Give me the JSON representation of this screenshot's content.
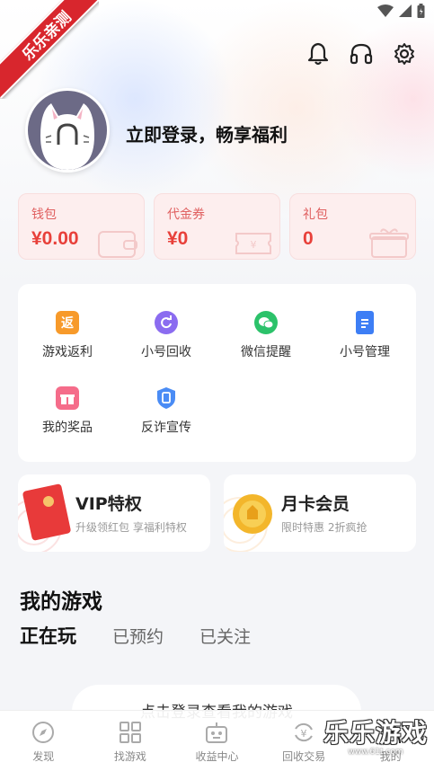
{
  "ribbon": {
    "text": "乐乐亲测"
  },
  "header": {
    "icons": [
      "bell-icon",
      "headset-icon",
      "gear-icon"
    ]
  },
  "profile": {
    "login_prompt": "立即登录，畅享福利"
  },
  "cards": [
    {
      "label": "钱包",
      "value": "¥0.00",
      "icon": "wallet-icon"
    },
    {
      "label": "代金券",
      "value": "¥0",
      "icon": "coupon-icon"
    },
    {
      "label": "礼包",
      "value": "0",
      "icon": "gift-box-icon"
    }
  ],
  "menu": [
    {
      "label": "游戏返利",
      "icon": "rebate-icon",
      "badge": "返",
      "color": "#f79a2a"
    },
    {
      "label": "小号回收",
      "icon": "recycle-icon",
      "color": "#8b6cf0"
    },
    {
      "label": "微信提醒",
      "icon": "wechat-icon",
      "color": "#2cc26a"
    },
    {
      "label": "小号管理",
      "icon": "clipboard-icon",
      "color": "#3d7ef5"
    },
    {
      "label": "我的奖品",
      "icon": "prize-icon",
      "color": "#f56c8a"
    },
    {
      "label": "反诈宣传",
      "icon": "shield-icon",
      "color": "#4a8cf5"
    }
  ],
  "promos": [
    {
      "title": "VIP特权",
      "subtitle": "升级领红包 享福利特权",
      "icon": "red-envelope-icon"
    },
    {
      "title": "月卡会员",
      "subtitle": "限时特惠 2折疯抢",
      "icon": "gold-coin-icon"
    }
  ],
  "my_games": {
    "title": "我的游戏",
    "tabs": [
      {
        "label": "正在玩",
        "active": true
      },
      {
        "label": "已预约",
        "active": false
      },
      {
        "label": "已关注",
        "active": false
      }
    ],
    "login_button": "点击登录查看我的游戏"
  },
  "bottom_nav": [
    {
      "label": "发现",
      "icon": "compass-icon"
    },
    {
      "label": "找游戏",
      "icon": "grid-icon"
    },
    {
      "label": "收益中心",
      "icon": "robot-icon"
    },
    {
      "label": "回收交易",
      "icon": "exchange-icon"
    },
    {
      "label": "我的",
      "icon": "user-icon"
    }
  ],
  "watermark": {
    "text": "乐乐游戏",
    "url": "www.61t.com"
  },
  "colors": {
    "accent_red": "#e8403a",
    "card_bg": "#fdeeee",
    "page_bg": "#f4f5f8"
  }
}
